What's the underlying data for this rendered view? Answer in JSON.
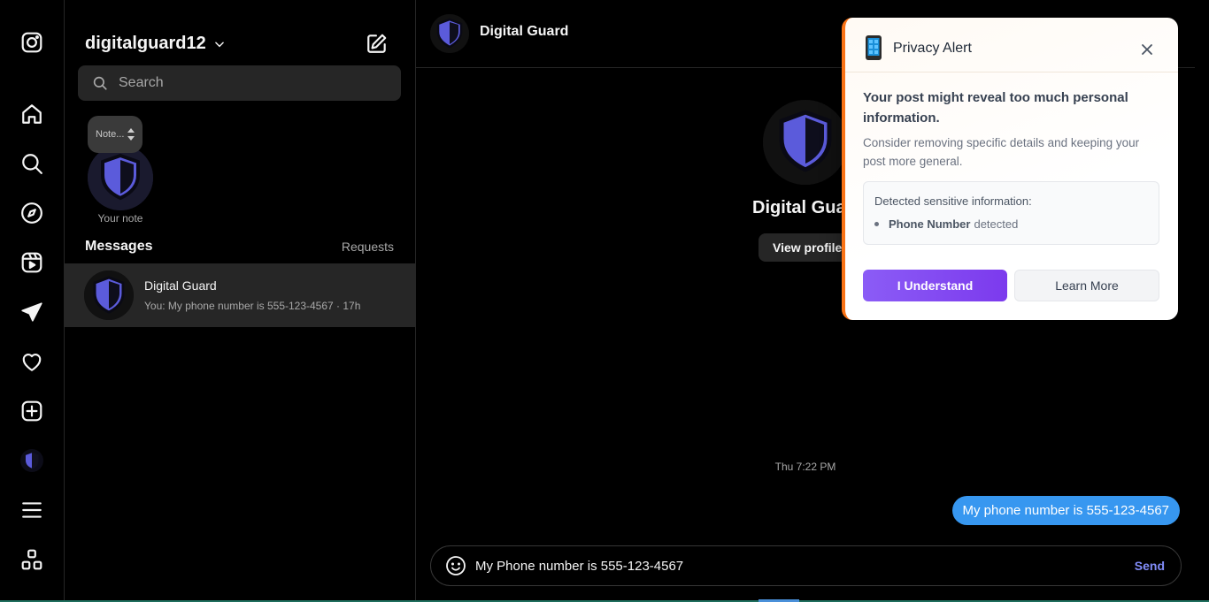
{
  "nav": {
    "items": [
      {
        "name": "instagram-logo"
      },
      {
        "name": "home"
      },
      {
        "name": "search"
      },
      {
        "name": "explore"
      },
      {
        "name": "reels"
      },
      {
        "name": "messages"
      },
      {
        "name": "notifications"
      },
      {
        "name": "create"
      },
      {
        "name": "profile"
      },
      {
        "name": "more"
      },
      {
        "name": "apps"
      }
    ]
  },
  "inbox": {
    "username": "digitalguard12",
    "search_placeholder": "Search",
    "note_placeholder": "Note...",
    "note_label": "Your note",
    "messages_heading": "Messages",
    "requests_label": "Requests",
    "conversations": [
      {
        "name": "Digital Guard",
        "preview": "You: My phone number is 555-123-4567 · 17h"
      }
    ]
  },
  "chat": {
    "header_name": "Digital Guard",
    "profile_name": "Digital Guard",
    "view_profile_label": "View profile",
    "timestamp": "Thu 7:22 PM",
    "messages": [
      {
        "from": "me",
        "text": "My phone number is 555-123-4567"
      }
    ],
    "composer_value": "My Phone number is 555-123-4567",
    "send_label": "Send"
  },
  "privacy_alert": {
    "title": "Privacy Alert",
    "message": "Your post might reveal too much personal information.",
    "suggestion": "Consider removing specific details and keeping your post more general.",
    "detected_heading": "Detected sensitive information:",
    "detected_items": [
      {
        "type": "Phone Number",
        "status": "detected"
      }
    ],
    "primary_button": "I Understand",
    "secondary_button": "Learn More",
    "accent_color": "#f97316",
    "button_color": "#8b5cf6"
  },
  "colors": {
    "message_bubble": "#3797f0",
    "shield": "#5b5bdb",
    "send": "#818cf8"
  }
}
